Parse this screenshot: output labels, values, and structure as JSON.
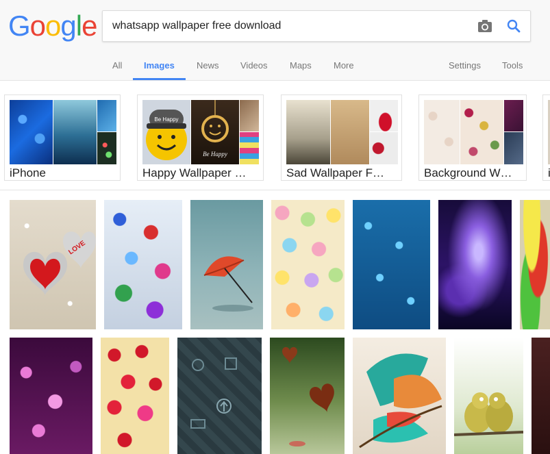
{
  "logo": {
    "letters": [
      {
        "ch": "G",
        "color": "#4285F4"
      },
      {
        "ch": "o",
        "color": "#EA4335"
      },
      {
        "ch": "o",
        "color": "#FBBC05"
      },
      {
        "ch": "g",
        "color": "#4285F4"
      },
      {
        "ch": "l",
        "color": "#34A853"
      },
      {
        "ch": "e",
        "color": "#EA4335"
      }
    ]
  },
  "search": {
    "query": "whatsapp wallpaper free download"
  },
  "tabs": {
    "all": "All",
    "images": "Images",
    "news": "News",
    "videos": "Videos",
    "maps": "Maps",
    "more": "More",
    "settings": "Settings",
    "tools": "Tools"
  },
  "related": [
    {
      "label": "iPhone"
    },
    {
      "label": "Happy Wallpaper …"
    },
    {
      "label": "Sad Wallpaper F…"
    },
    {
      "label": "Background W…"
    },
    {
      "label": "i"
    }
  ],
  "thumb_text": {
    "be_happy": "Be Happy",
    "love": "LOVE"
  },
  "colors": {
    "accent": "#4285f4",
    "tab_inactive": "#777777"
  }
}
